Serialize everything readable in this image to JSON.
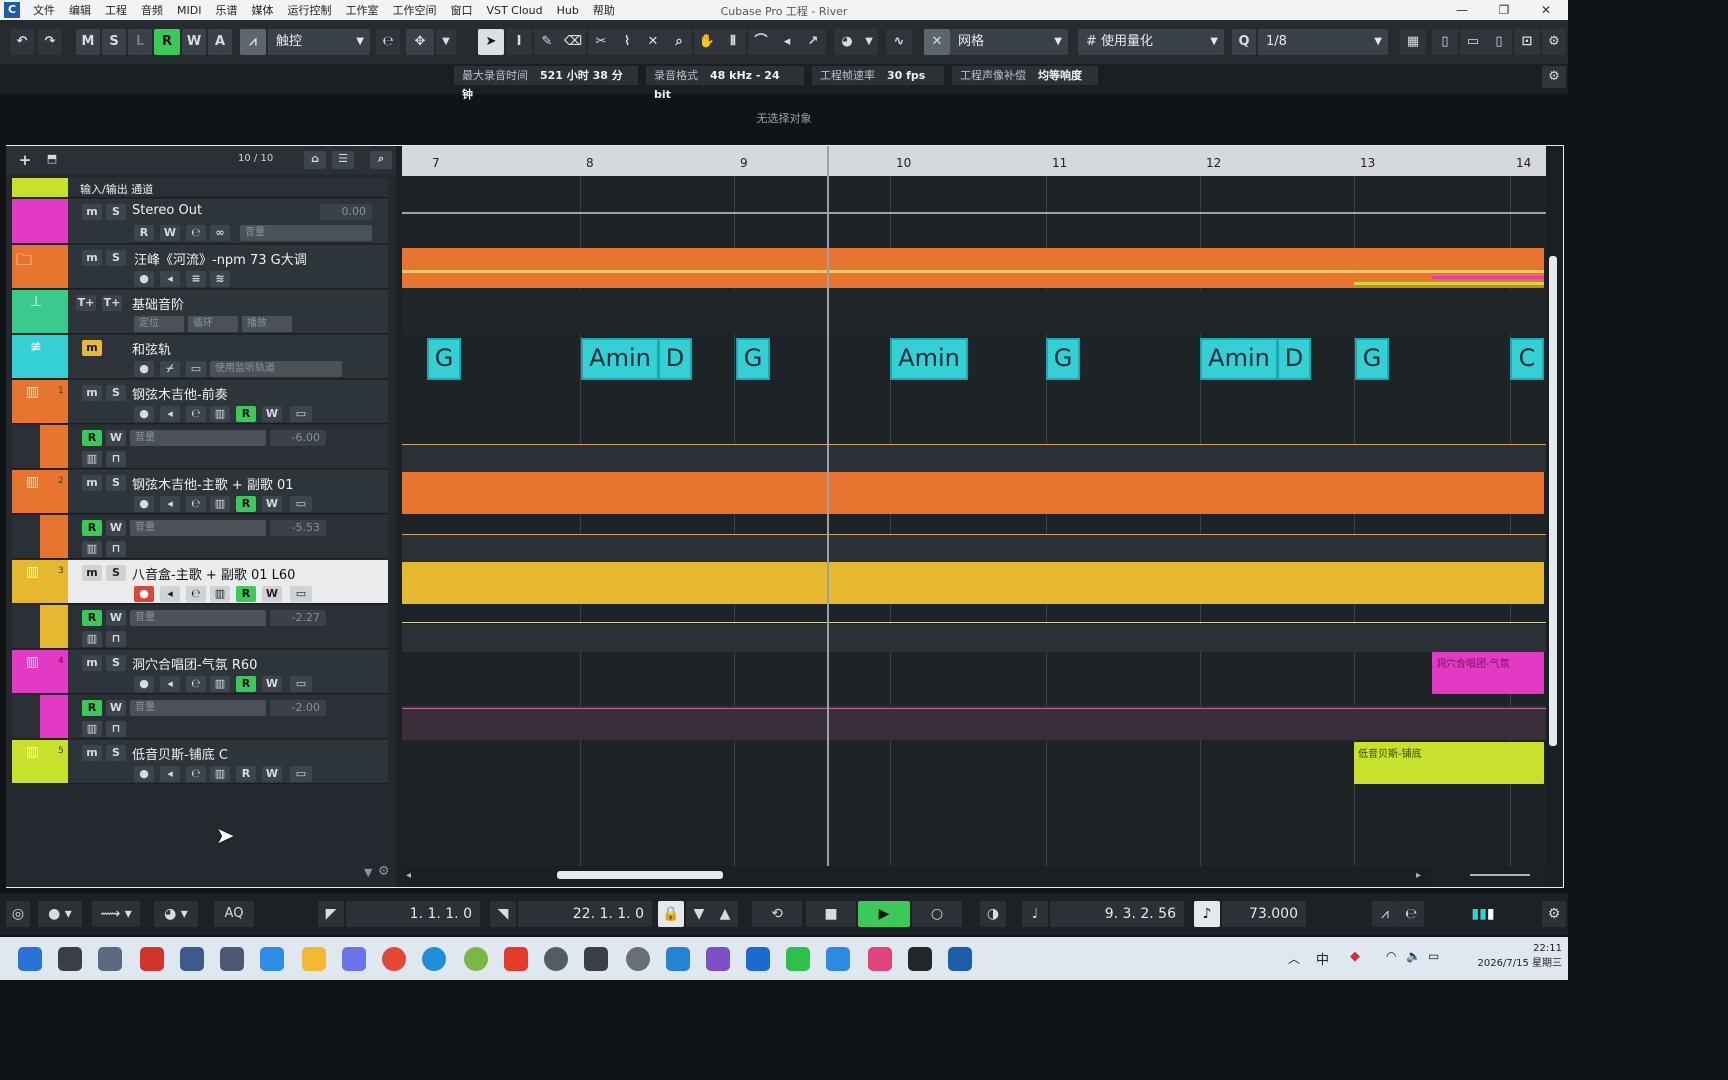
{
  "window": {
    "title": "Cubase Pro 工程 - River",
    "logo": "C"
  },
  "menu": [
    "文件",
    "编辑",
    "工程",
    "音频",
    "MIDI",
    "乐谱",
    "媒体",
    "运行控制",
    "工作室",
    "工作空间",
    "窗口",
    "VST Cloud",
    "Hub",
    "帮助"
  ],
  "toolbar": {
    "undo_icon": "↶",
    "redo_icon": "↷",
    "modes": [
      "M",
      "S",
      "L",
      "R",
      "W",
      "A"
    ],
    "touch_label": "触控",
    "grid_label": "网格",
    "quantize_label": "使用量化",
    "quantize_value": "1/8",
    "q_label": "Q"
  },
  "infoline": [
    {
      "label": "最大录音时间",
      "value": "521 小时 38 分钟"
    },
    {
      "label": "录音格式",
      "value": "48 kHz - 24 bit"
    },
    {
      "label": "工程帧速率",
      "value": "30 fps"
    },
    {
      "label": "工程声像补偿",
      "value": "均等响度"
    }
  ],
  "no_selection": "无选择对象",
  "tracklist": {
    "count": "10 / 10",
    "folder_label": "输入/输出 通道",
    "tracks": [
      {
        "name": "Stereo Out",
        "value": "0.00",
        "field": "音量"
      },
      {
        "name": "汪峰《河流》-npm 73 G大调"
      },
      {
        "name": "基础音阶",
        "f1": "定位",
        "f2": "循环",
        "f3": "播放"
      },
      {
        "name": "和弦轨",
        "field": "使用监听轨道"
      },
      {
        "name": "钢弦木吉他-前奏",
        "num": "1",
        "vol": "-6.00",
        "field": "音量"
      },
      {
        "name": "钢弦木吉他-主歌 + 副歌 01",
        "num": "2",
        "vol": "-5.53",
        "field": "音量"
      },
      {
        "name": "八音盒-主歌 + 副歌 01 L60",
        "num": "3",
        "vol": "-2.27",
        "field": "音量"
      },
      {
        "name": "洞穴合唱团-气氛 R60",
        "num": "4",
        "vol": "-2.00",
        "field": "音量"
      },
      {
        "name": "低音贝斯-铺底 C",
        "num": "5"
      }
    ]
  },
  "ruler": {
    "bars": [
      "7",
      "8",
      "9",
      "10",
      "11",
      "12",
      "13",
      "14"
    ]
  },
  "chords": [
    "G",
    "Amin",
    "D",
    "G",
    "Amin",
    "G",
    "Amin",
    "D",
    "G",
    "C"
  ],
  "events": {
    "choir_label": "洞穴合唱团-气氛",
    "bass_label": "低音贝斯-铺底"
  },
  "transport": {
    "left_locator": "1. 1. 1.   0",
    "right_locator": "22. 1. 1.   0",
    "position": "9. 3. 2. 56",
    "tempo": "73.000",
    "aq": "AQ"
  },
  "taskbar": {
    "time": "22:11",
    "date": "2026/7/15 星期三",
    "ime": "中"
  },
  "colors": {
    "orange": "#e8752f",
    "yellow": "#e5b830",
    "magenta": "#e23ac4",
    "lime": "#c7e12c",
    "cyan": "#35d0d6",
    "green": "#3dc85a"
  }
}
